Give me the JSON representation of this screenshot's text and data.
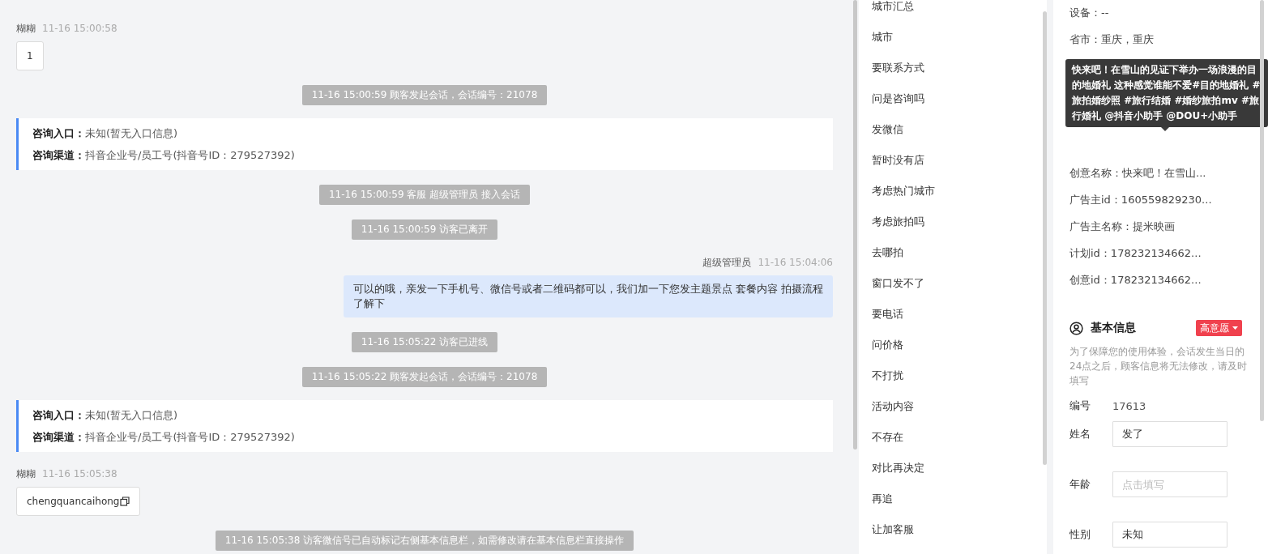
{
  "chat": {
    "items": [
      {
        "kind": "visitor",
        "name": "糊糊",
        "time": "11-16 15:00:58",
        "text": "1",
        "copy": false
      },
      {
        "kind": "system",
        "text": "11-16 15:00:59 顾客发起会话，会话编号：21078"
      },
      {
        "kind": "info",
        "rows": [
          {
            "label": "咨询入口：",
            "value": "未知(暂无入口信息)"
          },
          {
            "label": "咨询渠道：",
            "value": "抖音企业号/员工号(抖音号ID：279527392)"
          }
        ]
      },
      {
        "kind": "system",
        "text": "11-16 15:00:59 客服 超级管理员 接入会话"
      },
      {
        "kind": "system",
        "text": "11-16 15:00:59 访客已离开"
      },
      {
        "kind": "agent",
        "name": "超级管理员",
        "time": "11-16 15:04:06",
        "text": "可以的哦，亲发一下手机号、微信号或者二维码都可以，我们加一下您发主题景点 套餐内容 拍摄流程了解下"
      },
      {
        "kind": "system",
        "text": "11-16 15:05:22 访客已进线"
      },
      {
        "kind": "system",
        "text": "11-16 15:05:22 顾客发起会话，会话编号：21078"
      },
      {
        "kind": "info",
        "rows": [
          {
            "label": "咨询入口：",
            "value": "未知(暂无入口信息)"
          },
          {
            "label": "咨询渠道：",
            "value": "抖音企业号/员工号(抖音号ID：279527392)"
          }
        ]
      },
      {
        "kind": "visitor",
        "name": "糊糊",
        "time": "11-16 15:05:38",
        "text": "chengquancaihong",
        "copy": true
      },
      {
        "kind": "system",
        "text": "11-16 15:05:38 访客微信号已自动标记右侧基本信息栏，如需修改请在基本信息栏直接操作"
      }
    ]
  },
  "quick_replies": [
    "城市汇总",
    "城市",
    "要联系方式",
    "问是咨询吗",
    "发微信",
    "暂时没有店",
    "考虑热门城市",
    "考虑旅拍吗",
    "去哪拍",
    "窗口发不了",
    "要电话",
    "问价格",
    "不打扰",
    "活动内容",
    "不存在",
    "对比再决定",
    "再追",
    "让加客服"
  ],
  "source_info": {
    "rows_top": [
      "设备：--",
      "省市：重庆，重庆"
    ],
    "rows_bottom": [
      "创意名称：快来吧！在雪山...",
      "广告主id：160559829230...",
      "广告主名称：提米映画",
      "计划id：178232134662...",
      "创意id：178232134662..."
    ],
    "tooltip": "快来吧！在雪山的见证下举办一场浪漫的目的地婚礼 这种感觉谁能不爱#目的地婚礼 #旅拍婚纱照 #旅行结婚 #婚纱旅拍mv #旅行婚礼 @抖音小助手 @DOU+小助手"
  },
  "basic_info": {
    "title": "基本信息",
    "tag": "高意愿",
    "note": "为了保障您的使用体验，会话发生当日的24点之后，顾客信息将无法修改，请及时填写",
    "fields": [
      {
        "kind": "text",
        "label": "编号",
        "value": "17613"
      },
      {
        "kind": "input",
        "label": "姓名",
        "value": "发了"
      },
      {
        "kind": "input",
        "label": "年龄",
        "placeholder": "点击填写"
      },
      {
        "kind": "input",
        "label": "性别",
        "value": "未知"
      }
    ]
  }
}
